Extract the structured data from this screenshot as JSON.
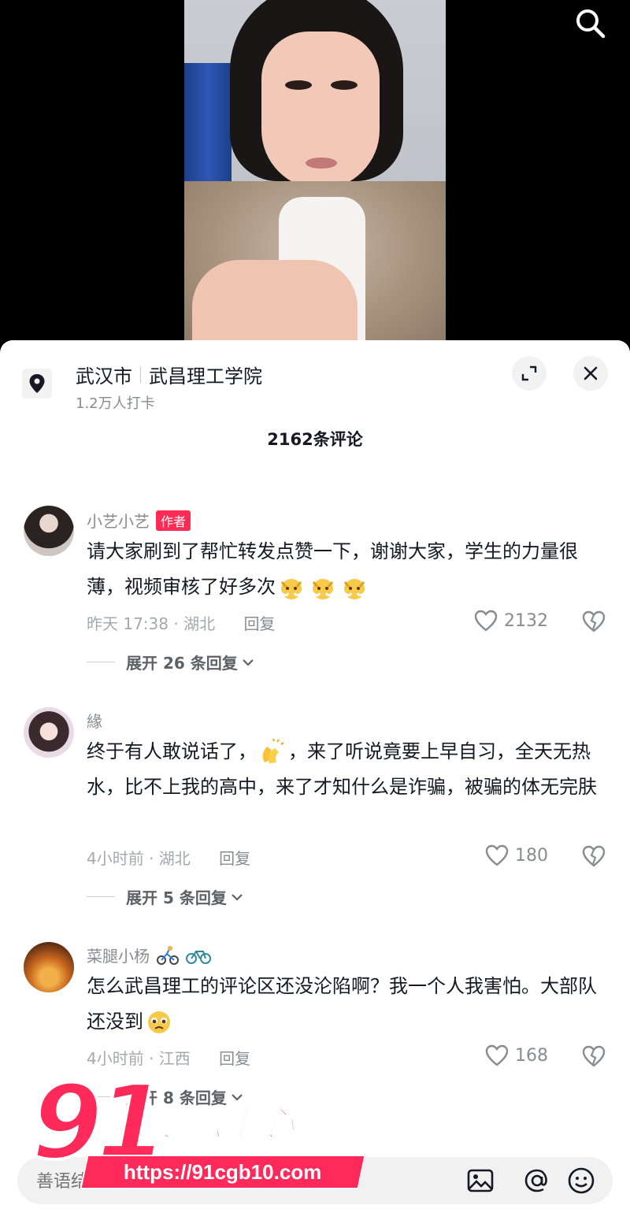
{
  "location": {
    "city": "武汉市",
    "place": "武昌理工学院",
    "checkins": "1.2万人打卡"
  },
  "comment_count": "2162条评论",
  "comments": [
    {
      "user": "小艺小艺",
      "author_tag": "作者",
      "text": "请大家刷到了帮忙转发点赞一下，谢谢大家，学生的力量很薄，视频审核了好多次",
      "time_region": "昨天 17:38 · 湖北",
      "reply_label": "回复",
      "likes": "2132",
      "expand": "展开 26 条回复"
    },
    {
      "user": "緣",
      "text_before_emoji": "终于有人敢说话了，",
      "text_after_emoji": "，来了听说竟要上早自习，全天无热水，比不上我的高中，来了才知什么是诈骗，被骗的体无完肤",
      "time_region": "4小时前 · 湖北",
      "reply_label": "回复",
      "likes": "180",
      "expand": "展开 5 条回复"
    },
    {
      "user": "菜腿小杨",
      "text": "怎么武昌理工的评论区还没沦陷啊？我一个人我害怕。大部队还没到",
      "time_region": "4小时前 · 江西",
      "reply_label": "回复",
      "likes": "168",
      "expand": "展开 8 条回复"
    }
  ],
  "input": {
    "placeholder": "善语结善缘，恶言伤人心"
  },
  "watermark": {
    "number": "91",
    "name": "吃瓜中心",
    "url": "https://91cgb10.com"
  },
  "colors": {
    "accent": "#fe2c55",
    "text_primary": "#161823",
    "text_secondary": "#8a8b91"
  },
  "icons": [
    "search-icon",
    "location-pin-icon",
    "expand-icon",
    "close-icon",
    "heart-icon",
    "broken-heart-icon",
    "image-icon",
    "at-icon",
    "emoji-icon"
  ]
}
